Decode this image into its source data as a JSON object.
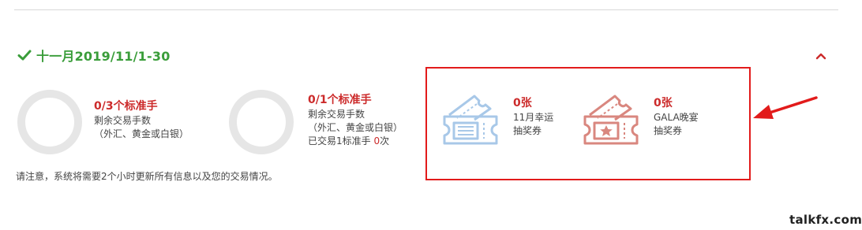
{
  "month": {
    "title": "十一月2019/11/1-30"
  },
  "progress": [
    {
      "headline": "0/3个标准手",
      "line1": "剩余交易手数",
      "line2": "（外汇、黄金或白银）",
      "value": 0
    },
    {
      "headline": "0/1个标准手",
      "line1": "剩余交易手数",
      "line2": "（外汇、黄金或白银）",
      "traded_prefix": "已交易1标准手 ",
      "traded_count": "0",
      "traded_suffix": "次",
      "value": 0
    }
  ],
  "notice": "请注意，系统将需要2个小时更新所有信息以及您的交易情况。",
  "tickets": [
    {
      "count": "0张",
      "line1": "11月幸运",
      "line2": "抽奖券",
      "icon": "ticket-icon",
      "color": "#a8c8e8"
    },
    {
      "count": "0张",
      "line1": "GALA晚宴",
      "line2": "抽奖券",
      "icon": "ticket-star-icon",
      "color": "#d9877f"
    }
  ],
  "watermark": "talkfx.com",
  "colors": {
    "accent_green": "#3a9d3a",
    "accent_red": "#cc2b2b",
    "box_red": "#e21b1b"
  }
}
